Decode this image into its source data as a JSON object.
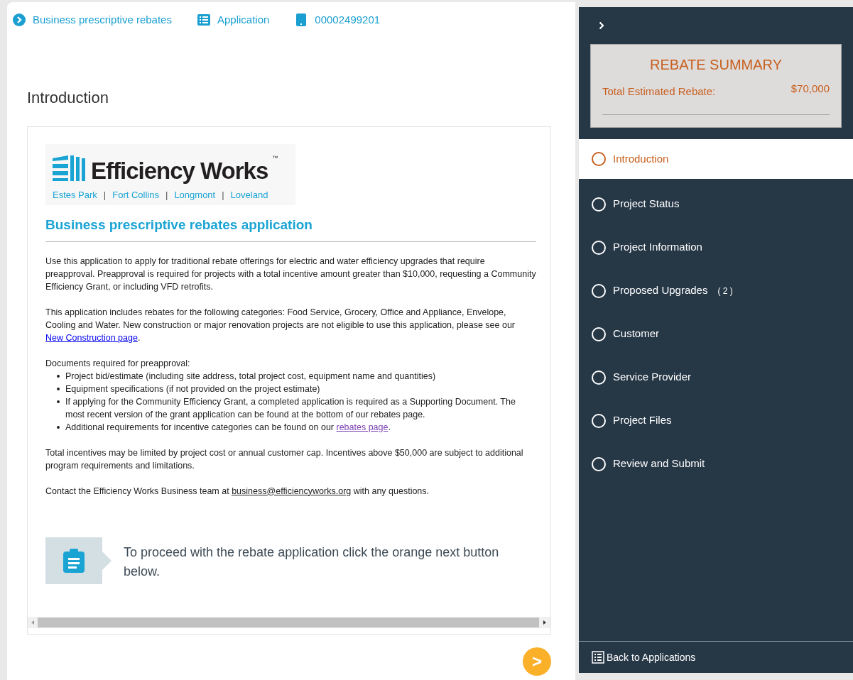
{
  "breadcrumbs": [
    {
      "kind": "chevron",
      "label": "Business prescriptive rebates"
    },
    {
      "kind": "list",
      "label": "Application"
    },
    {
      "kind": "tablet",
      "label": "00002499201"
    }
  ],
  "page_title": "Introduction",
  "logo": {
    "name": "Efficiency Works",
    "mark": "™",
    "cities": [
      "Estes Park",
      "Fort Collins",
      "Longmont",
      "Loveland"
    ],
    "separator": "|"
  },
  "heading": "Business prescriptive rebates application",
  "blocks": [
    {
      "kind": "para",
      "text": "Use this application to apply for traditional rebate offerings for electric and water efficiency upgrades that require preapproval. Preapproval is required for projects with a total incentive amount greater than $10,000, requesting a Community Efficiency Grant, or including VFD retrofits."
    },
    {
      "kind": "para",
      "text": "This application includes rebates for the following categories: Food Service, Grocery, Office and Appliance, Envelope, Cooling and Water. New construction or major renovation projects are not eligible to use this application, please see our ",
      "link": "New Construction page",
      "color": "#0000ee",
      "after": "."
    },
    {
      "kind": "list",
      "title": "Documents required for preapproval:",
      "items": [
        {
          "text": "Project bid/estimate (including site address, total project cost, equipment name and quantities)"
        },
        {
          "text": "Equipment specifications (if not provided on the project estimate)"
        },
        {
          "text": "If applying for the Community Efficiency Grant, a completed application is required as a Supporting Document. The most recent version of the grant application can be found at the bottom of our rebates page."
        },
        {
          "text": "Additional requirements for incentive categories can be found on our ",
          "link": "rebates page",
          "color": "#7b3fb3",
          "after": "."
        }
      ]
    },
    {
      "kind": "para",
      "text": "Total incentives may be limited by project cost or annual customer cap. Incentives above $50,000 are subject to additional program requirements and limitations."
    },
    {
      "kind": "para",
      "text": "Contact the Efficiency Works Business team at ",
      "link": "business@efficiencyworks.org",
      "color": "#222222",
      "after": " with any questions."
    }
  ],
  "callout": "To proceed with the rebate application click the orange next button below.",
  "next_button": ">",
  "sidebar": {
    "summary": {
      "title": "REBATE SUMMARY",
      "label": "Total Estimated Rebate:",
      "value": "$70,000"
    },
    "steps": [
      {
        "label": "Introduction",
        "selected": true
      },
      {
        "label": "Project Status",
        "selected": false
      },
      {
        "label": "Project Information",
        "selected": false
      },
      {
        "label": "Proposed Upgrades",
        "selected": false,
        "count": "( 2 )"
      },
      {
        "label": "Customer",
        "selected": false
      },
      {
        "label": "Service Provider",
        "selected": false
      },
      {
        "label": "Project Files",
        "selected": false
      },
      {
        "label": "Review and Submit",
        "selected": false
      }
    ],
    "back_link": "Back to Applications"
  }
}
